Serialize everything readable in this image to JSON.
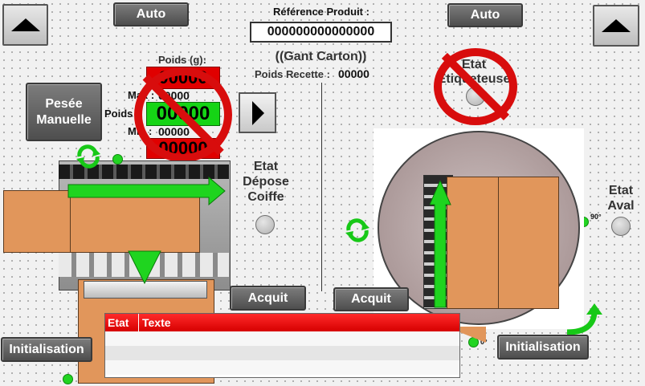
{
  "buttons": {
    "auto_left": "Auto",
    "auto_right": "Auto",
    "pesee_manuelle": "Pesée Manuelle",
    "acquit_left": "Acquit",
    "acquit_right": "Acquit",
    "init_left": "Initialisation",
    "init_right": "Initialisation"
  },
  "product": {
    "ref_label": "Référence Produit :",
    "ref_value": "000000000000000",
    "carton_label": "((Gant Carton))",
    "poids_recette_label": "Poids Recette :",
    "poids_recette_value": "00000"
  },
  "weighing": {
    "poids_label": "Poids (g):",
    "top_value": "00000",
    "max_label": "Max :",
    "max_value": "00000",
    "poids_mesure_label": "Poids",
    "poids_mesure_value": "00000",
    "min_label": "Min :",
    "min_value": "00000",
    "bottom_value": "00000"
  },
  "status": {
    "etat_depose_coiffe": "Etat Dépose Coiffe",
    "etat_etiqueteuse": "Etat Etiqueteuse",
    "etat_aval": "Etat Aval"
  },
  "angles": {
    "a90": "90°",
    "a0": "0°"
  },
  "alarm_table": {
    "columns": [
      "Etat",
      "Texte"
    ],
    "rows": [
      [
        "",
        ""
      ],
      [
        "",
        ""
      ],
      [
        "",
        ""
      ]
    ]
  },
  "colors": {
    "accent_green": "#22d422",
    "alarm_red": "#e00000",
    "carton": "#e1965b",
    "button_gray": "#666666"
  }
}
